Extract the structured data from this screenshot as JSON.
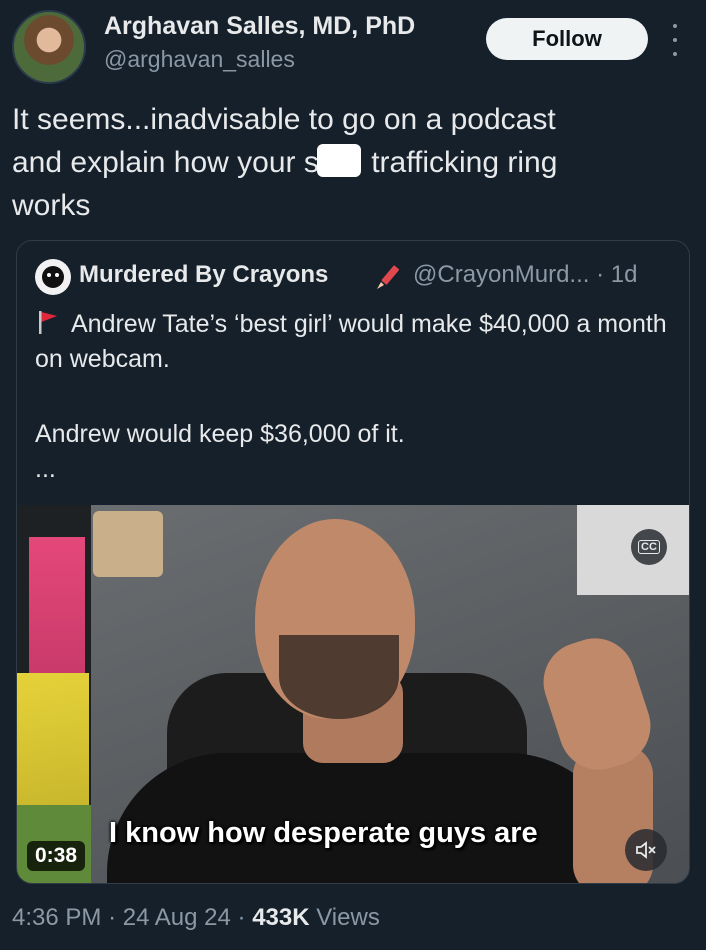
{
  "author": {
    "name": "Arghavan Salles, MD, PhD",
    "handle": "@arghavan_salles",
    "follow_label": "Follow"
  },
  "tweet": {
    "line1": "It seems...inadvisable to go on a podcast",
    "line2_a": "and explain how your ",
    "line2_redacted_first": "s",
    "line2_b": " trafficking ring",
    "line3": "works"
  },
  "quote": {
    "name": "Murdered By Crayons",
    "handle": "@CrayonMurd...",
    "time": "· 1d",
    "line1": "Andrew Tate’s ‘best girl’ would make $40,000 a month on webcam.",
    "line2": "Andrew would keep $36,000 of it.",
    "ellipsis": "...",
    "video": {
      "subtitle": "I know how desperate guys are",
      "duration": "0:38",
      "cc_label": "CC"
    }
  },
  "meta": {
    "time": "4:36 PM",
    "date": "24 Aug 24",
    "views_count": "433K",
    "views_label": "Views"
  },
  "colors": {
    "background": "#15202b",
    "text": "#e7e9ea",
    "secondary_text": "#8b98a5",
    "follow_bg": "#eff3f4"
  },
  "icons": [
    "more-icon",
    "crayon-icon",
    "flag-icon",
    "cc-icon",
    "mute-icon"
  ]
}
